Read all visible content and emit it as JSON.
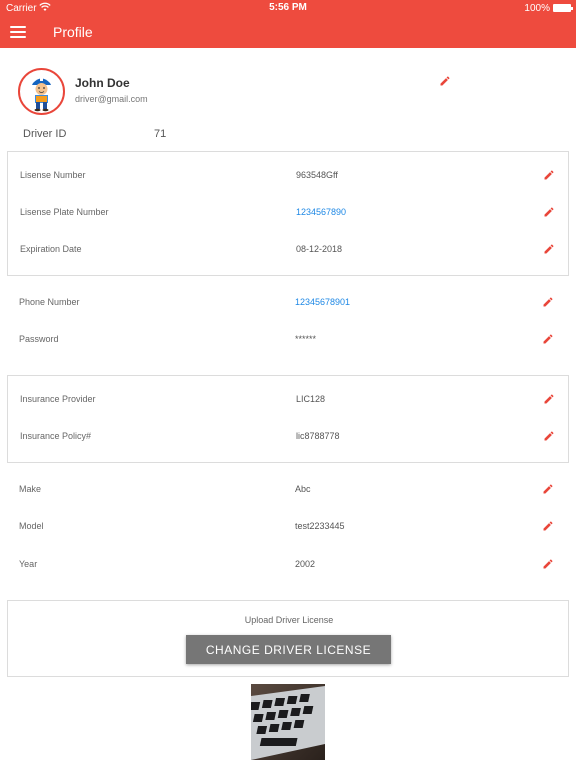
{
  "status_bar": {
    "carrier": "Carrier",
    "time": "5:56 PM",
    "battery": "100%"
  },
  "app_bar": {
    "title": "Profile"
  },
  "profile": {
    "name": "John Doe",
    "email": "driver@gmail.com",
    "driver_id_label": "Driver ID",
    "driver_id_value": "71"
  },
  "license_section": {
    "rows": [
      {
        "label": "Lisense Number",
        "value": "963548Gff"
      },
      {
        "label": "Lisense Plate Number",
        "value": "1234567890"
      },
      {
        "label": "Expiration Date",
        "value": "08-12-2018"
      }
    ]
  },
  "account_section": {
    "rows": [
      {
        "label": "Phone Number",
        "value": "12345678901"
      },
      {
        "label": "Password",
        "value": "******"
      }
    ]
  },
  "insurance_section": {
    "rows": [
      {
        "label": "Insurance Provider",
        "value": "LIC128"
      },
      {
        "label": "Insurance Policy#",
        "value": "lic8788778"
      }
    ]
  },
  "vehicle_section": {
    "rows": [
      {
        "label": "Make",
        "value": "Abc"
      },
      {
        "label": "Model",
        "value": "test2233445"
      },
      {
        "label": "Year",
        "value": "2002"
      }
    ]
  },
  "upload": {
    "label": "Upload Driver License",
    "button": "CHANGE DRIVER LICENSE"
  },
  "colors": {
    "accent": "#ee4b3e",
    "link": "#1e88e5",
    "button": "#767676"
  },
  "icons": {
    "menu": "hamburger-menu-icon",
    "edit": "pencil-icon",
    "wifi": "wifi-icon",
    "battery": "battery-icon"
  }
}
